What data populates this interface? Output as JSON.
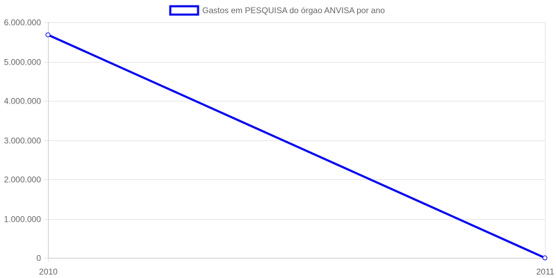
{
  "chart_data": {
    "type": "line",
    "title": "",
    "xlabel": "",
    "ylabel": "",
    "categories": [
      "2010",
      "2011"
    ],
    "series": [
      {
        "name": "Gastos em PESQUISA do órgao ANVISA por ano",
        "values": [
          5680000,
          0
        ],
        "color": "#0000ee"
      }
    ],
    "ylim": [
      0,
      6000000
    ],
    "yticks": [
      0,
      1000000,
      2000000,
      3000000,
      4000000,
      5000000,
      6000000
    ],
    "ytick_labels": [
      "0",
      "1.000.000",
      "2.000.000",
      "3.000.000",
      "4.000.000",
      "5.000.000",
      "6.000.000"
    ],
    "grid": true,
    "legend_position": "top"
  }
}
